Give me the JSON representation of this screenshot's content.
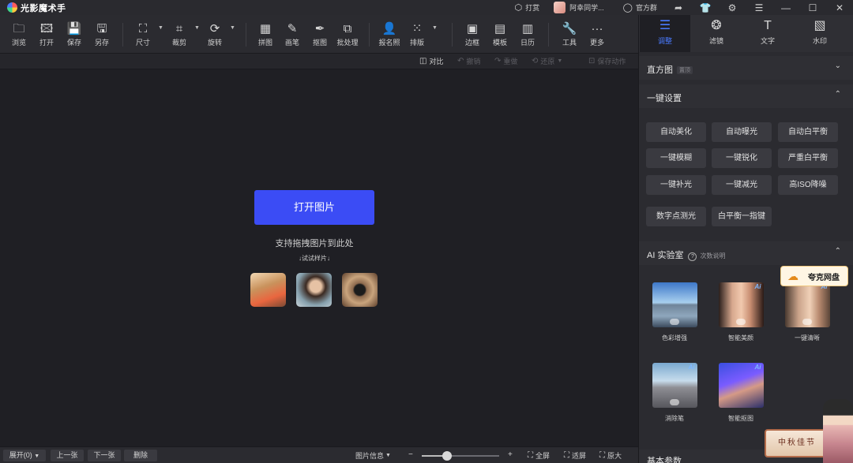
{
  "app": {
    "title": "光影魔术手"
  },
  "titlebar": {
    "reward": "打赏",
    "username": "阿幸同学...",
    "group": "官方群"
  },
  "toolbar": {
    "browse": "浏览",
    "open": "打开",
    "save": "保存",
    "save_as": "另存",
    "size": "尺寸",
    "crop": "裁剪",
    "rotate": "旋转",
    "collage": "拼图",
    "brush": "画笔",
    "cutout": "抠图",
    "batch": "批处理",
    "id_photo": "报名照",
    "layout": "排版",
    "border": "边框",
    "template": "模板",
    "calendar": "日历",
    "tools": "工具",
    "more": "更多"
  },
  "subtoolbar": {
    "compare": "对比",
    "undo": "撤销",
    "redo": "重做",
    "restore": "还原",
    "save_action": "保存动作"
  },
  "canvas": {
    "open_button": "打开图片",
    "drag_tip": "支持拖拽图片到此处",
    "sample_tip": "↓试试样片↓"
  },
  "bottombar": {
    "expand": "展开(0)",
    "prev": "上一张",
    "next": "下一张",
    "delete": "删除",
    "image_info": "图片信息",
    "fullscreen": "全屏",
    "fit": "适屏",
    "original": "原大",
    "zoom_level": 0.33
  },
  "rpanel": {
    "tabs": [
      {
        "label": "调整",
        "icon": "sliders-icon"
      },
      {
        "label": "滤镜",
        "icon": "filter-icon"
      },
      {
        "label": "文字",
        "icon": "text-icon"
      },
      {
        "label": "水印",
        "icon": "watermark-icon"
      }
    ],
    "histogram": {
      "title": "直方图",
      "tag": "置顶"
    },
    "one_click": {
      "title": "一键设置",
      "buttons": [
        "自动美化",
        "自动曝光",
        "自动白平衡",
        "一键模糊",
        "一键锐化",
        "严重白平衡",
        "一键补光",
        "一键减光",
        "高ISO降噪",
        "数字点测光",
        "白平衡一指键"
      ]
    },
    "ai_lab": {
      "title": "AI 实验室",
      "help": "次数说明",
      "items": [
        "色彩增强",
        "智能美颜",
        "一键清晰",
        "消除笔",
        "智能抠图"
      ],
      "badge": "Ai"
    },
    "basic_params": {
      "title": "基本参数"
    }
  },
  "widgets": {
    "cloud_drive": "夸克网盘",
    "deco_text": "中秋佳节"
  },
  "colors": {
    "accent": "#3b4cf5",
    "active_tab": "#4a7bff",
    "background": "#1f1f24",
    "panel": "#2b2b30"
  }
}
